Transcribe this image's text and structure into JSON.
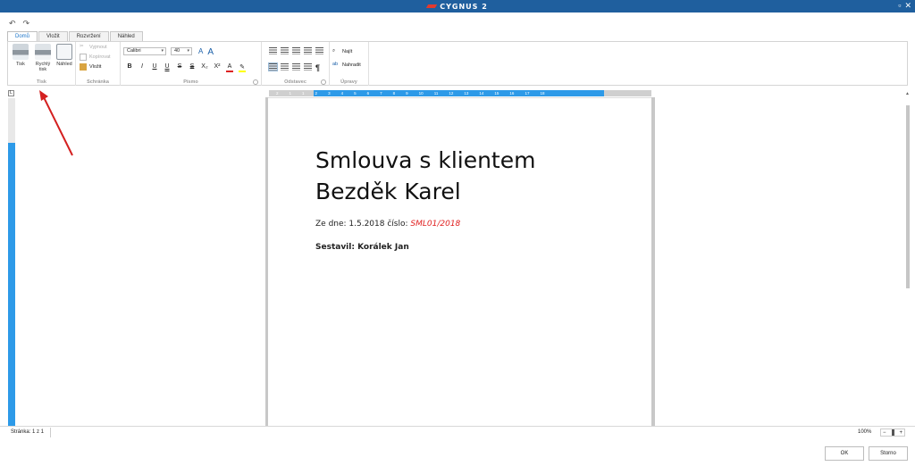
{
  "window": {
    "brand": "CYGNUS 2",
    "restore_icon": "restore-icon",
    "close_icon": "close-icon"
  },
  "quick_access": {
    "undo_icon": "undo-icon",
    "redo_icon": "redo-icon"
  },
  "tabs": [
    {
      "label": "Domů",
      "active": true
    },
    {
      "label": "Vložit",
      "active": false
    },
    {
      "label": "Rozvržení",
      "active": false
    },
    {
      "label": "Náhled",
      "active": false
    }
  ],
  "ribbon": {
    "print_group": {
      "label": "Tisk",
      "print": "Tisk",
      "quick_print": "Rychlý tisk",
      "preview": "Náhled"
    },
    "clipboard_group": {
      "label": "Schránka",
      "cut": "Vyjmout",
      "copy": "Kopírovat",
      "paste": "Vložit"
    },
    "font_group": {
      "label": "Písmo",
      "font_name": "Calibri",
      "font_size": "40",
      "bold": "B",
      "italic": "I",
      "underline": "U",
      "double_underline": "U",
      "strike": "S",
      "double_strike": "S",
      "subscript": "X₂",
      "superscript": "X²",
      "font_color": "A",
      "grow": "A",
      "shrink": "A"
    },
    "paragraph_group": {
      "label": "Odstavec",
      "pilcrow": "¶"
    },
    "edit_group": {
      "label": "Úpravy",
      "find": "Najít",
      "replace": "Nahradit"
    }
  },
  "ruler": {
    "corner": "L",
    "ticks": [
      "2",
      "1",
      "1",
      "2",
      "3",
      "4",
      "5",
      "6",
      "7",
      "8",
      "9",
      "10",
      "11",
      "12",
      "13",
      "14",
      "15",
      "16",
      "17",
      "18"
    ]
  },
  "document": {
    "title_line1": "Smlouva s klientem",
    "title_line2": "Bezděk Karel",
    "date_prefix": "Ze dne: 1.5.2018 číslo: ",
    "number": "SML01/2018",
    "author": "Sestavil: Korálek Jan"
  },
  "status": {
    "page": "Stránka: 1 z 1",
    "zoom": "100%",
    "zoom_minus": "−",
    "zoom_plus": "+"
  },
  "buttons": {
    "ok": "OK",
    "cancel": "Storno"
  },
  "colors": {
    "titlebar": "#1f5f9e",
    "accent": "#1a73c8",
    "ruler_active": "#2d9ae8",
    "annotation_arrow": "#d42020",
    "doc_number": "#e02020"
  }
}
